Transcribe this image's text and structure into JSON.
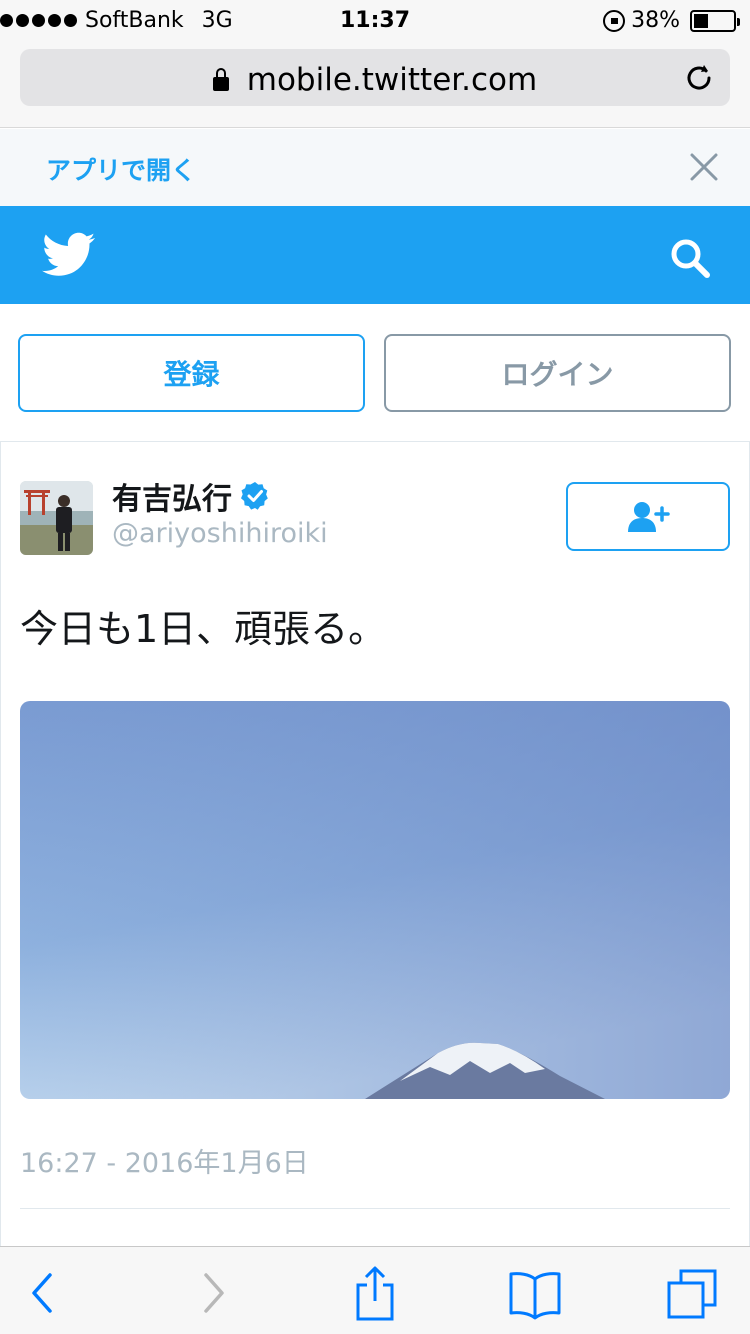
{
  "status_bar": {
    "carrier": "SoftBank",
    "network": "3G",
    "time": "11:37",
    "battery_percent": "38%",
    "battery_level": 0.38
  },
  "browser": {
    "url": "mobile.twitter.com",
    "icons": [
      "lock-icon",
      "reload-icon"
    ]
  },
  "banner": {
    "open_in_app": "アプリで開く",
    "icons": [
      "close-icon"
    ]
  },
  "header": {
    "brand_color": "#1da1f2",
    "icons": [
      "twitter-bird-icon",
      "search-icon"
    ]
  },
  "auth": {
    "signup_label": "登録",
    "login_label": "ログイン"
  },
  "tweet": {
    "author_name": "有吉弘行",
    "handle": "@ariyoshihiroiki",
    "verified": true,
    "text": "今日も1日、頑張る。",
    "timestamp": "16:27 - 2016年1月6日",
    "icons": [
      "verified-badge-icon",
      "follow-user-icon"
    ]
  },
  "toolbar": {
    "icons": [
      "back-icon",
      "forward-icon",
      "share-icon",
      "bookmarks-icon",
      "tabs-icon"
    ]
  }
}
